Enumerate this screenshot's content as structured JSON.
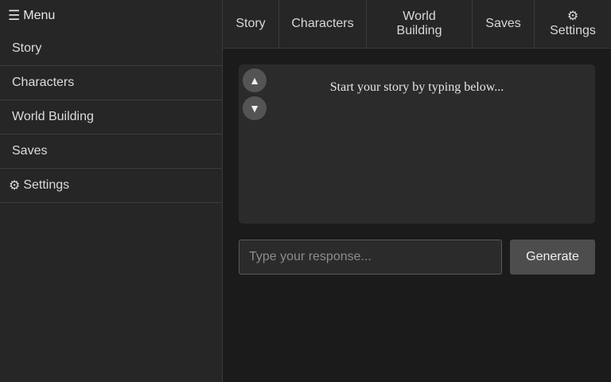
{
  "sidebar": {
    "header": {
      "glyph": "☰",
      "label": "Menu"
    },
    "items": [
      {
        "glyph": "",
        "label": "Story"
      },
      {
        "glyph": "",
        "label": "Characters"
      },
      {
        "glyph": "",
        "label": "World Building"
      },
      {
        "glyph": "",
        "label": "Saves"
      },
      {
        "glyph": "⚙",
        "label": "Settings"
      }
    ]
  },
  "tabs": [
    {
      "glyph": "",
      "line1": "",
      "line2": "Story"
    },
    {
      "glyph": "",
      "line1": "",
      "line2": "Characters"
    },
    {
      "glyph": "",
      "line1": "World",
      "line2": "Building"
    },
    {
      "glyph": "",
      "line1": "",
      "line2": "Saves"
    },
    {
      "glyph": "⚙",
      "line1": "",
      "line2": "Settings"
    }
  ],
  "story": {
    "placeholder_text": "Start your story by typing below...",
    "scroll_up": "▲",
    "scroll_down": "▼"
  },
  "input": {
    "placeholder": "Type your response...",
    "value": ""
  },
  "generate_label": "Generate",
  "icons": {
    "menu": "hamburger-icon",
    "story": "missing-glyph-icon",
    "characters": "missing-glyph-icon",
    "world": "missing-glyph-icon",
    "saves": "missing-glyph-icon",
    "settings": "gear-icon"
  },
  "colors": {
    "background": "#1b1b1b",
    "sidebar": "#262626",
    "panel": "#2b2b2b",
    "button": "#4d4d4d"
  }
}
